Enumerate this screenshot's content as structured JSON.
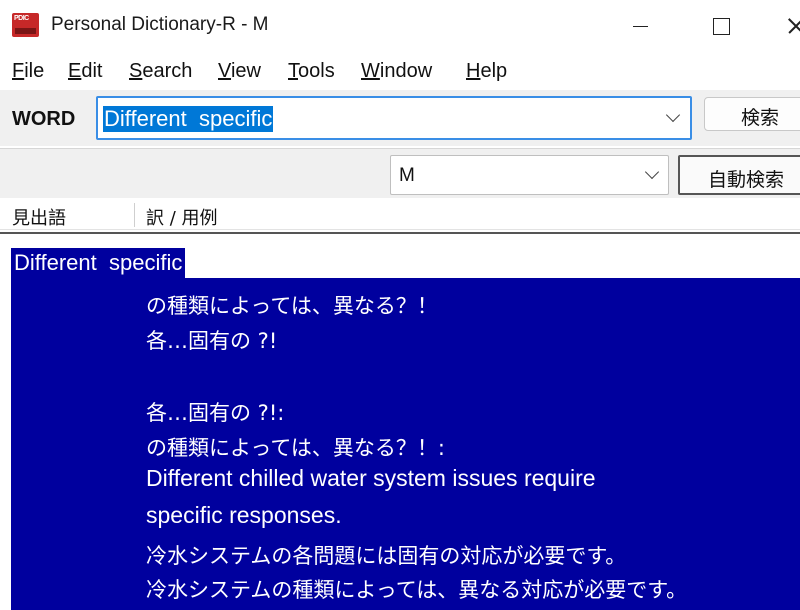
{
  "window": {
    "title": "Personal Dictionary-R - M",
    "icon_text": "PDIC"
  },
  "menu": {
    "items": [
      {
        "label": "File",
        "mnemonic": "F"
      },
      {
        "label": "Edit",
        "mnemonic": "E"
      },
      {
        "label": "Search",
        "mnemonic": "S"
      },
      {
        "label": "View",
        "mnemonic": "V"
      },
      {
        "label": "Tools",
        "mnemonic": "T"
      },
      {
        "label": "Window",
        "mnemonic": "W"
      },
      {
        "label": "Help",
        "mnemonic": "H"
      }
    ]
  },
  "toolbar": {
    "word_label": "WORD",
    "word_value": "Different  specific",
    "search_button": "検索",
    "dictionary_value": "M",
    "auto_search_button": "自動検索"
  },
  "columns": {
    "headword": "見出語",
    "translation": "訳 / 用例"
  },
  "entry": {
    "headword": "Different  specific",
    "lines": [
      "の種類によっては、異なる？！",
      "各…固有の ?!",
      "",
      "各…固有の ?!:",
      "の種類によっては、異なる？！:",
      "Different chilled water system issues require",
      "specific responses.",
      "冷水システムの各問題には固有の対応が必要です。",
      "冷水システムの種類によっては、異なる対応が必要です。"
    ]
  },
  "colors": {
    "selection": "#00009e",
    "input_highlight": "#0078d7",
    "focus_border": "#3a8ee6"
  },
  "icons": {
    "app": "pdic-book-icon",
    "minimize": "minimize-icon",
    "maximize": "maximize-icon",
    "close": "close-icon",
    "dropdown": "chevron-down-icon"
  }
}
